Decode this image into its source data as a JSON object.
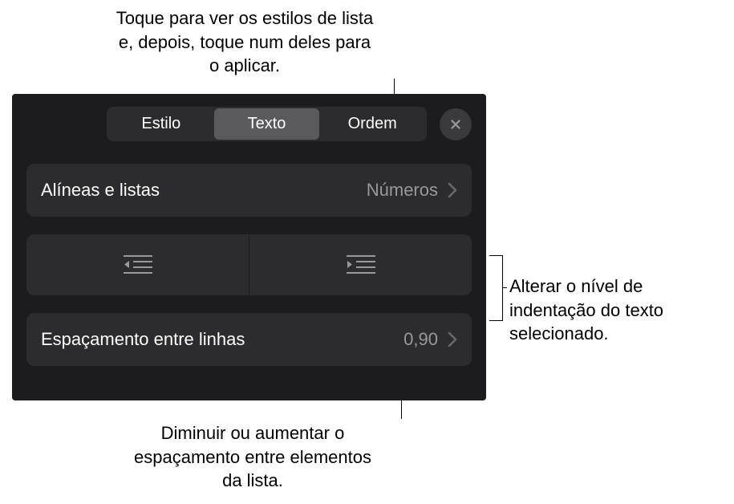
{
  "callouts": {
    "top": "Toque para ver os estilos de lista e, depois, toque num deles para o aplicar.",
    "right": "Alterar o nível de indentação do texto selecionado.",
    "bottom": "Diminuir ou aumentar o espaçamento entre elementos da lista."
  },
  "tabs": {
    "style": "Estilo",
    "text": "Texto",
    "order": "Ordem"
  },
  "rows": {
    "bullets_lists": {
      "label": "Alíneas e listas",
      "value": "Números"
    },
    "line_spacing": {
      "label": "Espaçamento entre linhas",
      "value": "0,90"
    }
  },
  "icons": {
    "close": "close-icon",
    "chevron_right": "chevron-right-icon",
    "outdent": "outdent-icon",
    "indent": "indent-icon"
  }
}
